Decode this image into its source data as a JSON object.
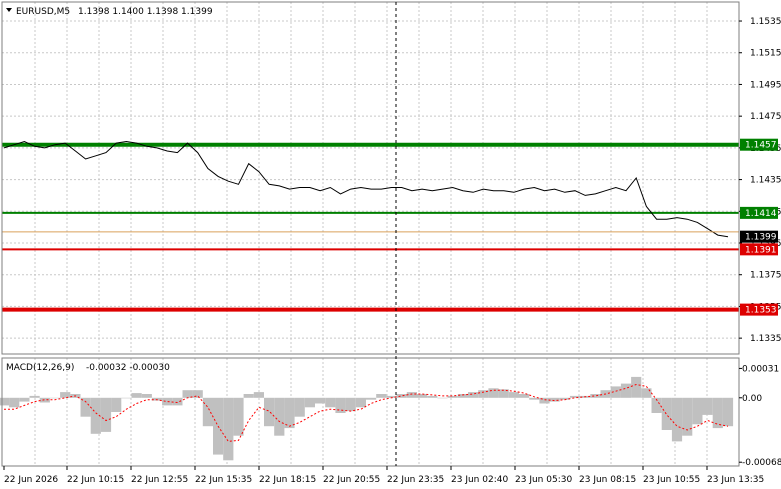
{
  "main_header": {
    "symbol": "EURUSD,M5",
    "ohlc": "1.1398 1.1400 1.1398 1.1399",
    "arrow": "down-triangle-icon"
  },
  "macd_header": {
    "label": "MACD(12,26,9)",
    "values": "-0.00032 -0.00030"
  },
  "colors": {
    "background": "#ffffff",
    "grid": "#c8c8c8",
    "price_line": "#000000",
    "green_level": "#008000",
    "red_level": "#dd0000",
    "histogram": "#c0c0c0",
    "signal": "#ff0000",
    "bid_line": "#d9a05b"
  },
  "chart_data": [
    {
      "type": "line",
      "title": "",
      "y_ticks": [
        "1.1535",
        "1.1515",
        "1.1495",
        "1.1475",
        "1.1455",
        "1.1435",
        "1.1415",
        "1.1395",
        "1.1375",
        "1.1355",
        "1.1335"
      ],
      "ylim": [
        1.1325,
        1.1547
      ],
      "x_ticks": [
        "22 Jun 2026",
        "22 Jun 10:15",
        "22 Jun 12:55",
        "22 Jun 15:35",
        "22 Jun 18:15",
        "22 Jun 20:55",
        "22 Jun 23:35",
        "23 Jun 02:40",
        "23 Jun 05:30",
        "23 Jun 08:15",
        "23 Jun 10:55",
        "23 Jun 13:35"
      ],
      "grid": true,
      "series": [
        {
          "values": [
            1.1455,
            1.1457,
            1.1459,
            1.1456,
            1.1455,
            1.1457,
            1.1458,
            1.1453,
            1.1448,
            1.145,
            1.1452,
            1.1458,
            1.1459,
            1.1458,
            1.1456,
            1.1455,
            1.1453,
            1.1452,
            1.1458,
            1.1452,
            1.1442,
            1.1437,
            1.1434,
            1.1432,
            1.1445,
            1.144,
            1.1432,
            1.1431,
            1.1429,
            1.143,
            1.143,
            1.1428,
            1.143,
            1.1426,
            1.1429,
            1.143,
            1.1429,
            1.1429,
            1.143,
            1.143,
            1.1428,
            1.1429,
            1.1428,
            1.1429,
            1.143,
            1.1428,
            1.1427,
            1.1429,
            1.1428,
            1.1428,
            1.1427,
            1.1429,
            1.143,
            1.1428,
            1.1429,
            1.1427,
            1.1428,
            1.1425,
            1.1426,
            1.1428,
            1.143,
            1.1428,
            1.1436,
            1.1418,
            1.141,
            1.141,
            1.1411,
            1.141,
            1.1408,
            1.1404,
            1.14,
            1.1399
          ]
        }
      ],
      "levels": [
        {
          "value": 1.1457,
          "label": "1.1457",
          "color": "#008000",
          "width": "thick"
        },
        {
          "value": 1.1414,
          "label": "1.1414",
          "color": "#008000",
          "width": "thin"
        },
        {
          "value": 1.1391,
          "label": "1.1391",
          "color": "#dd0000",
          "width": "thin"
        },
        {
          "value": 1.1353,
          "label": "1.1353",
          "color": "#dd0000",
          "width": "thick"
        }
      ],
      "current_price": {
        "value": 1.1399,
        "label": "1.1399"
      },
      "vertical_marker_time": "22 Jun 23:35"
    },
    {
      "type": "bar",
      "title": "MACD(12,26,9)",
      "y_ticks": [
        "0.00031",
        "0.00",
        "-0.00068"
      ],
      "ylim": [
        -0.00072,
        0.00042
      ],
      "series": [
        {
          "name": "MACD",
          "values": [
            -8e-05,
            -0.0001,
            -4e-05,
            2e-05,
            -5e-05,
            0.0,
            6e-05,
            4e-05,
            -0.0002,
            -0.00038,
            -0.00036,
            -0.00015,
            0.0,
            5e-05,
            4e-05,
            -3e-05,
            -8e-05,
            -8e-05,
            8e-05,
            8e-05,
            -0.0003,
            -0.0006,
            -0.00066,
            -0.0004,
            4e-05,
            6e-05,
            -0.0003,
            -0.0004,
            -0.00032,
            -0.0002,
            -0.0001,
            -6e-05,
            -0.0001,
            -0.00016,
            -0.00014,
            -0.0001,
            -2e-05,
            4e-05,
            2e-05,
            4e-05,
            6e-05,
            4e-05,
            2e-05,
            0.0,
            2e-05,
            4e-05,
            6e-05,
            8e-05,
            0.0001,
            9e-05,
            6e-05,
            4e-05,
            -2e-05,
            -6e-05,
            -4e-05,
            -2e-05,
            2e-05,
            2e-05,
            4e-05,
            8e-05,
            0.00012,
            0.00015,
            0.00022,
            0.0001,
            -0.00016,
            -0.00034,
            -0.00046,
            -0.0004,
            -0.00028,
            -0.00018,
            -0.00032,
            -0.0003
          ]
        },
        {
          "name": "Signal",
          "values": [
            -0.00012,
            -0.00012,
            -8e-05,
            -4e-05,
            -2e-05,
            -2e-05,
            0.0,
            2e-05,
            -4e-05,
            -0.00016,
            -0.00024,
            -0.0002,
            -0.00012,
            -6e-05,
            -2e-05,
            -2e-05,
            -4e-05,
            -5e-05,
            0.0,
            2e-05,
            -0.0001,
            -0.0003,
            -0.00046,
            -0.00045,
            -0.00024,
            -0.0001,
            -0.00014,
            -0.00025,
            -0.0003,
            -0.00026,
            -0.0002,
            -0.00014,
            -0.00012,
            -0.00013,
            -0.00014,
            -0.00012,
            -6e-05,
            -2e-05,
            0.0,
            2e-05,
            4e-05,
            4e-05,
            3e-05,
            2e-05,
            2e-05,
            3e-05,
            4e-05,
            6e-05,
            8e-05,
            8e-05,
            7e-05,
            5e-05,
            1e-05,
            -2e-05,
            -3e-05,
            -2e-05,
            0.0,
            1e-05,
            2e-05,
            4e-05,
            7e-05,
            0.0001,
            0.00014,
            0.00012,
            -2e-05,
            -0.00018,
            -0.0003,
            -0.00034,
            -0.0003,
            -0.00024,
            -0.00028,
            -0.0003
          ]
        }
      ]
    }
  ]
}
